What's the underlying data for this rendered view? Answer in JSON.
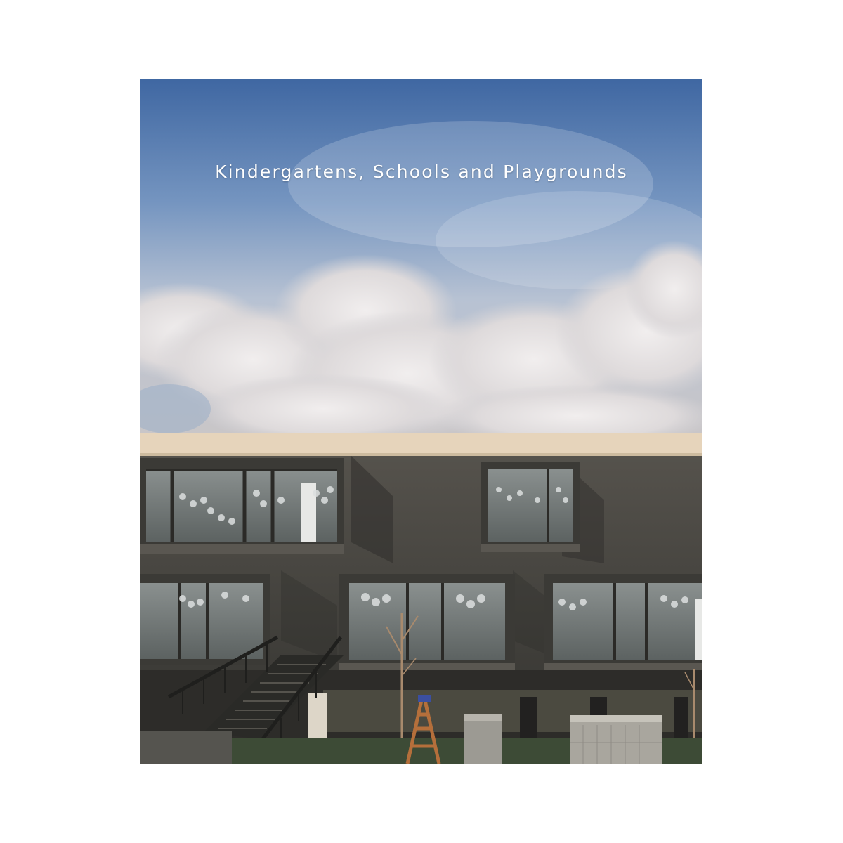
{
  "book": {
    "title": "Kindergartens, Schools and Playgrounds"
  },
  "colors": {
    "sky_top": "#3f6aa5",
    "sky_mid": "#7f9fc8",
    "cloud": "#e9e6e6",
    "roof": "#e6d4bb",
    "concrete": "#4a4843",
    "glass": "#6e7473",
    "grass": "#3b4a35"
  }
}
